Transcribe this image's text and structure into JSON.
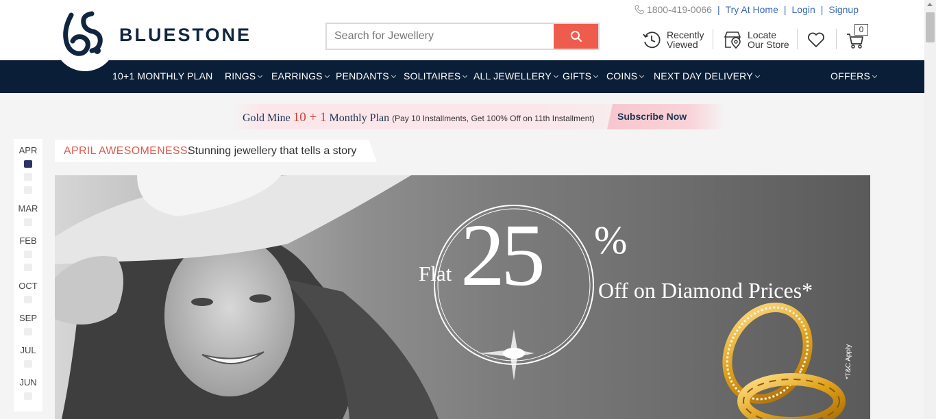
{
  "brand": {
    "name": "BLUESTONE",
    "color": "#10253f"
  },
  "search": {
    "placeholder": "Search for Jewellery"
  },
  "top_links": {
    "phone": "1800-419-0066",
    "try_at_home": "Try At Home",
    "login": "Login",
    "signup": "Signup",
    "separator": "|"
  },
  "utility": {
    "recently_viewed": [
      "Recently",
      "Viewed"
    ],
    "locate_store": [
      "Locate",
      "Our Store"
    ],
    "cart_count": "0"
  },
  "nav": {
    "items": [
      {
        "label": "10+1 MONTHLY PLAN"
      },
      {
        "label": "RINGS"
      },
      {
        "label": "EARRINGS"
      },
      {
        "label": "PENDANTS"
      },
      {
        "label": "SOLITAIRES"
      },
      {
        "label": "ALL JEWELLERY"
      },
      {
        "label": "GIFTS"
      },
      {
        "label": "COINS"
      },
      {
        "label": "NEXT DAY DELIVERY"
      },
      {
        "label": "OFFERS"
      }
    ],
    "background": "#0b1e37"
  },
  "promo": {
    "lead": "Gold Mine ",
    "highlight": "10 + 1",
    "plan": " Monthly Plan ",
    "detail": "(Pay 10 Installments, Get 100% Off on 11th Installment)",
    "cta": "Subscribe Now"
  },
  "timeline": {
    "months": [
      "APR",
      "MAR",
      "FEB",
      "OCT",
      "SEP",
      "JUL",
      "JUN"
    ],
    "active_color": "#2a3467"
  },
  "story": {
    "title": "APRIL AWESOMENESS:",
    "subtitle": "Stunning jewellery that tells a story",
    "title_color": "#e0584c"
  },
  "hero": {
    "flat": "Flat",
    "number": "25",
    "percent": "%",
    "offer": "Off on Diamond Prices*",
    "terms": "*T&C Apply"
  },
  "accent": "#ef5b4d"
}
